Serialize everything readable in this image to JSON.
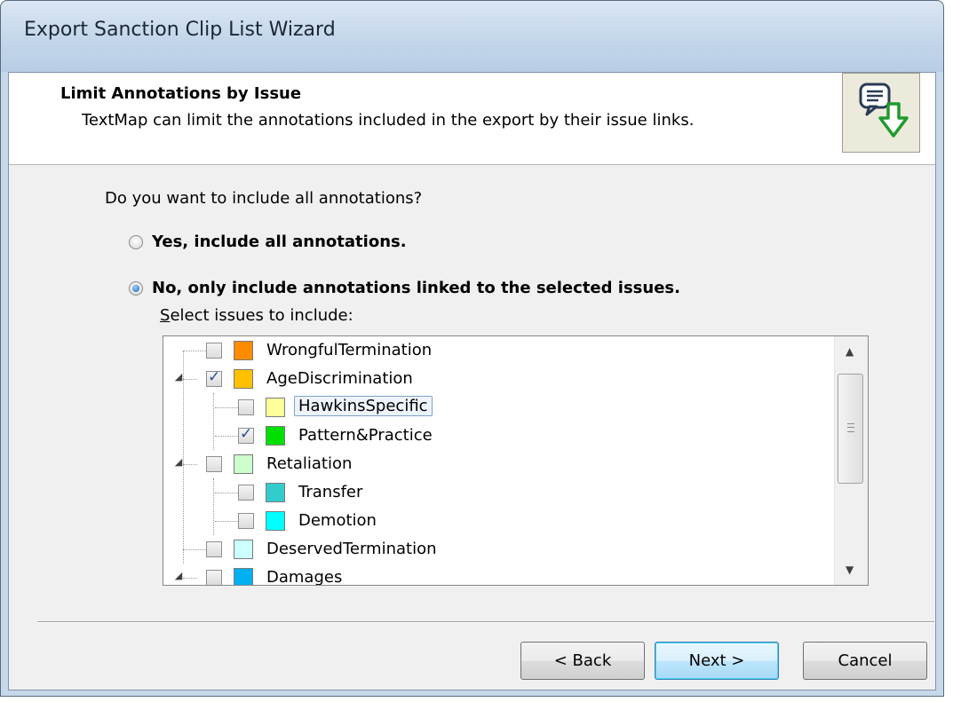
{
  "window": {
    "title": "Export Sanction Clip List Wizard"
  },
  "header": {
    "title": "Limit Annotations by Issue",
    "subtitle": "TextMap can limit the annotations included in the export by their issue links.",
    "icon": "annotation-export-icon"
  },
  "question": "Do you want to include all annotations?",
  "options": {
    "yes_label": "Yes, include all annotations.",
    "no_label": "No, only include annotations linked to the selected issues.",
    "selected": "no"
  },
  "issues_label": {
    "accesskey": "S",
    "rest": "elect issues to include:"
  },
  "issues": [
    {
      "label": "WrongfulTermination",
      "color": "#ff8c00",
      "checked": false,
      "level": 0,
      "expander": "none"
    },
    {
      "label": "AgeDiscrimination",
      "color": "#ffc000",
      "checked": true,
      "level": 0,
      "expander": "expanded"
    },
    {
      "label": "HawkinsSpecific",
      "color": "#ffff99",
      "checked": false,
      "level": 1,
      "expander": "none",
      "selected": true
    },
    {
      "label": "Pattern&Practice",
      "color": "#00e000",
      "checked": true,
      "level": 1,
      "expander": "none"
    },
    {
      "label": "Retaliation",
      "color": "#ccffcc",
      "checked": false,
      "level": 0,
      "expander": "expanded"
    },
    {
      "label": "Transfer",
      "color": "#33cccc",
      "checked": false,
      "level": 1,
      "expander": "none"
    },
    {
      "label": "Demotion",
      "color": "#00ffff",
      "checked": false,
      "level": 1,
      "expander": "none"
    },
    {
      "label": "DeservedTermination",
      "color": "#ccffff",
      "checked": false,
      "level": 0,
      "expander": "none"
    },
    {
      "label": "Damages",
      "color": "#00b0f0",
      "checked": false,
      "level": 0,
      "expander": "expanded"
    }
  ],
  "buttons": {
    "back": "< Back",
    "next": "Next >",
    "cancel": "Cancel"
  }
}
